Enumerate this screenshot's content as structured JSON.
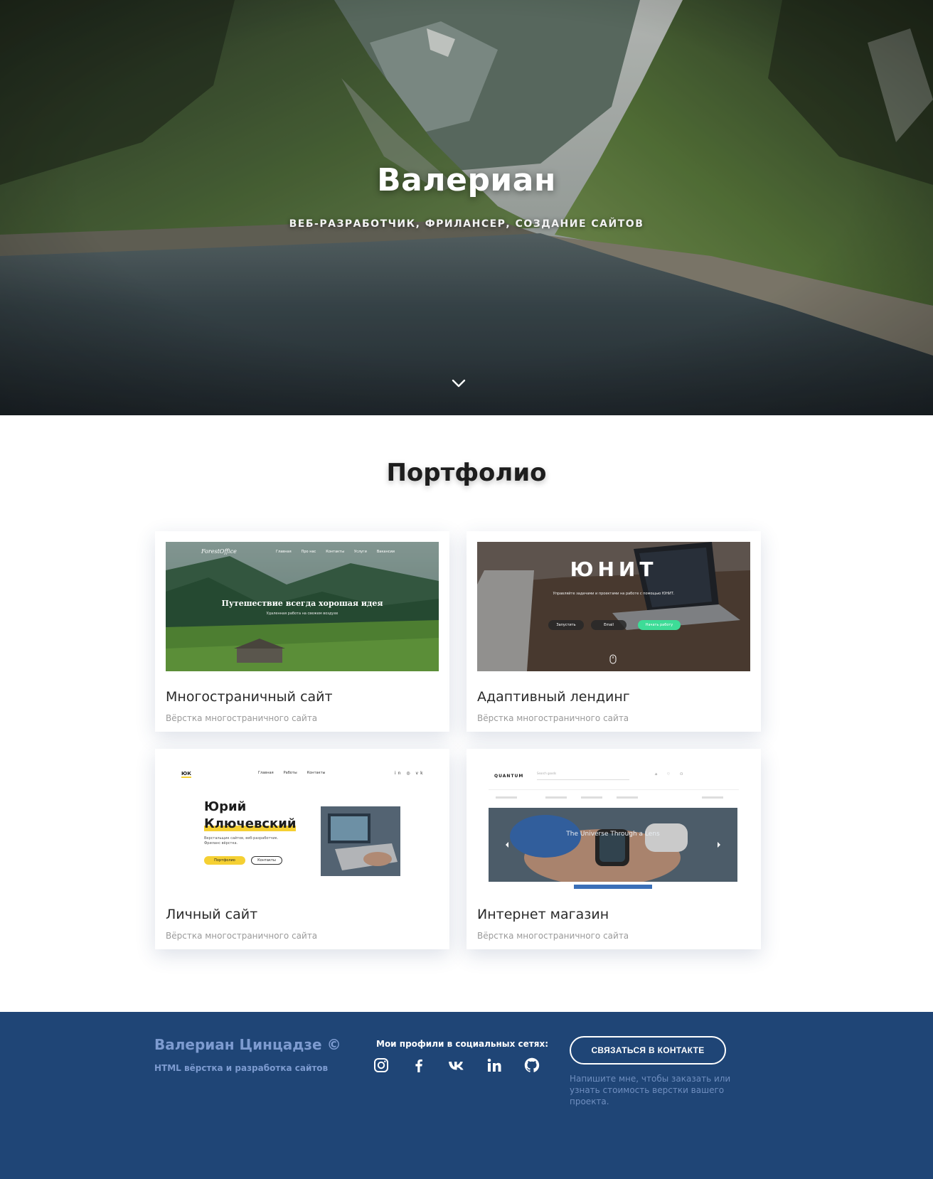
{
  "hero": {
    "title": "Валериан",
    "subtitle": "ВЕБ-РАЗРАБОТЧИК, ФРИЛАНСЕР, СОЗДАНИЕ САЙТОВ",
    "scroll_icon": "chevron-down-icon"
  },
  "portfolio": {
    "title": "Портфолио",
    "items": [
      {
        "title": "Многостраничный сайт",
        "description": "Вёрстка многостраничного сайта",
        "preview": {
          "logo": "ForestOffice",
          "nav": [
            "Главная",
            "Про нас",
            "Контакты",
            "Услуги",
            "Вакансии"
          ],
          "headline": "Путешествие всегда хорошая идея",
          "subline": "Удаленная работа на свежем воздухе"
        }
      },
      {
        "title": "Адаптивный лендинг",
        "description": "Вёрстка многостраничного сайта",
        "preview": {
          "headline": "ЮНИТ",
          "subline": "Управляйте задачами и проектами на работе с помощью ЮНИТ.",
          "buttons": [
            "Запустить",
            "Email",
            "Начать работу"
          ]
        }
      },
      {
        "title": "Личный сайт",
        "description": "Вёрстка многостраничного сайта",
        "preview": {
          "logo": "ЮК",
          "nav": [
            "Главная",
            "Работы",
            "Контакты"
          ],
          "name_line1": "Юрий",
          "name_line2": "Ключевский",
          "about": "Верстальщик сайтов, веб-разработчик. Фриланс вёрстка.",
          "buttons": [
            "Портфолио",
            "Контакты"
          ]
        }
      },
      {
        "title": "Интернет магазин",
        "description": "Вёрстка многостраничного сайта",
        "preview": {
          "logo": "QUANTUM",
          "search_placeholder": "Search goods",
          "banner": "The Universe Through a Lens"
        }
      }
    ]
  },
  "footer": {
    "name": "Валериан Цинцадзе ©",
    "tagline": "HTML вёрстка и разработка сайтов",
    "social_title": "Мои профили в социальных сетях:",
    "social_icons": [
      "instagram-icon",
      "facebook-icon",
      "vk-icon",
      "linkedin-icon",
      "github-icon"
    ],
    "contact_button": "СВЯЗАТЬСЯ В КОНТАКТЕ",
    "contact_note": "Напишите мне, чтобы заказать или узнать стоимость верстки вашего проекта."
  },
  "colors": {
    "footer_bg": "#1f4576",
    "footer_accent": "#7d9bd0",
    "accent_green": "#3ddc97",
    "accent_yellow": "#f5d033"
  }
}
